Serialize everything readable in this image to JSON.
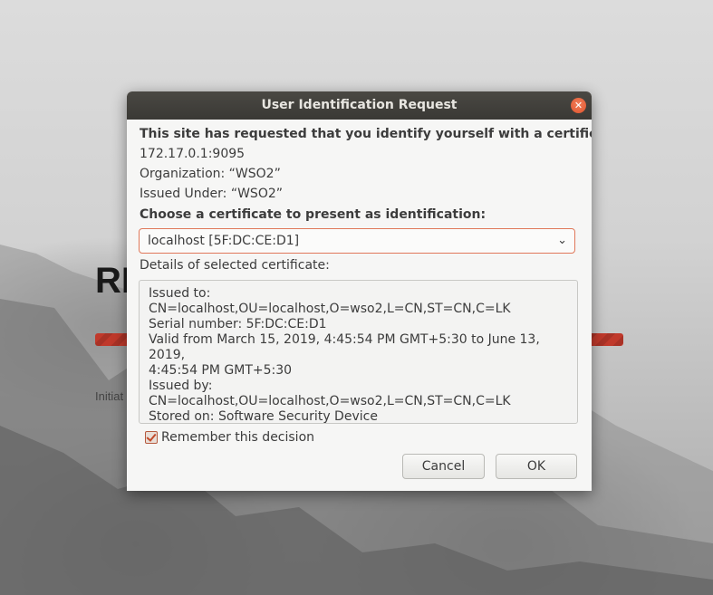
{
  "background": {
    "title": "RI",
    "status": "Initiat"
  },
  "dialog": {
    "title": "User Identification Request",
    "close_icon": "close-icon",
    "intro": "This site has requested that you identify yourself with a certificate:",
    "host": "172.17.0.1:9095",
    "organization": "Organization: “WSO2”",
    "issued_under": "Issued Under: “WSO2”",
    "choose_label": "Choose a certificate to present as identification:",
    "selected_certificate": "localhost [5F:DC:CE:D1]",
    "details_label": "Details of selected certificate:",
    "details": {
      "issued_to": "Issued to: CN=localhost,OU=localhost,O=wso2,L=CN,ST=CN,C=LK",
      "serial": "Serial number: 5F:DC:CE:D1",
      "valid": "Valid from March 15, 2019, 4:45:54 PM GMT+5:30 to June 13, 2019,",
      "valid_cont": "4:45:54 PM GMT+5:30",
      "issued_by": "Issued by: CN=localhost,OU=localhost,O=wso2,L=CN,ST=CN,C=LK",
      "stored_on": "Stored on: Software Security Device"
    },
    "remember_label": "Remember this decision",
    "remember_checked": true,
    "cancel_label": "Cancel",
    "ok_label": "OK"
  },
  "colors": {
    "titlebar": "#3a3935",
    "accent": "#e0532c",
    "dialog_bg": "#f6f6f5"
  }
}
